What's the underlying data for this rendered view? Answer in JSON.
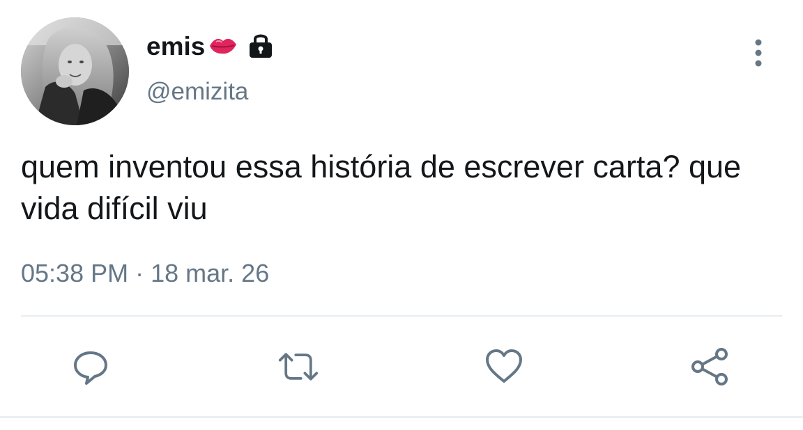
{
  "user": {
    "display_name": "emis",
    "handle": "@emizita",
    "name_emoji": "lips-icon",
    "protected_icon": "lock-icon"
  },
  "tweet": {
    "text": "quem inventou essa história de escrever carta? que vida difícil viu",
    "time": "05:38 PM",
    "separator": "·",
    "date": "18 mar. 26"
  },
  "actions": [
    {
      "name": "reply",
      "icon": "comment-icon"
    },
    {
      "name": "retweet",
      "icon": "retweet-icon"
    },
    {
      "name": "like",
      "icon": "heart-icon"
    },
    {
      "name": "share",
      "icon": "share-icon"
    }
  ],
  "colors": {
    "text": "#14171a",
    "secondary": "#657786",
    "divider": "#e6ecf0",
    "lips": "#e0245e"
  }
}
